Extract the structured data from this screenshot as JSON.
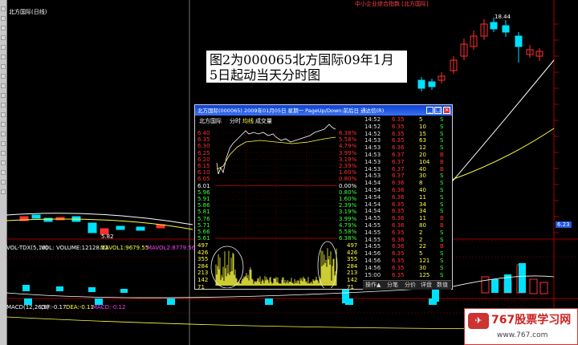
{
  "main_chart": {
    "title": "北方国际(日线)",
    "top_legend": "中小企业综合指数 [北方国际]",
    "high_label": "18.44",
    "low_label": "5.82",
    "current_price_tag": "6.23"
  },
  "volume_indicator": {
    "name": "VOL-TDX(5,10)",
    "vol_label": "VOL:",
    "volume": "VOLUME:12128.12",
    "mavol1": "MAVOL1:9679.55",
    "mavol2": "MAVOL2:8779.56"
  },
  "macd_indicator": {
    "name": "MACD(12,26,9)",
    "dif": "DIF:-0.17",
    "dea": "DEA:-0.11",
    "macd": "MACD:-0.12"
  },
  "annotation": {
    "line1": "图2为000065北方国际09年1月",
    "line2": "5日起动当天分时图"
  },
  "popup": {
    "title": "北方国际(000065)   2009年01月05日 星期一 PageUp/Down:前后日 通达信(R)",
    "min_label": "_",
    "max_label": "□",
    "close_label": "×",
    "legend_name": "北方国际",
    "legend_time": "分时",
    "legend_avg": "均线",
    "legend_vol": "成交量",
    "price_labels": [
      "6.40",
      "6.35",
      "6.30",
      "6.25",
      "6.20",
      "6.15",
      "6.10",
      "6.05",
      "6.01",
      "5.96",
      "5.91",
      "5.86",
      "5.81",
      "5.76",
      "5.71",
      "5.66",
      "5.61"
    ],
    "pct_labels": [
      "6.38%",
      "5.58%",
      "4.79%",
      "3.99%",
      "3.19%",
      "2.39%",
      "1.60%",
      "0.80%",
      "0.00%",
      "0.80%",
      "1.60%",
      "2.39%",
      "3.19%",
      "3.99%",
      "4.79%",
      "5.58%",
      "6.38%"
    ],
    "vol_labels": [
      "497",
      "426",
      "355",
      "284",
      "213",
      "142",
      "71"
    ],
    "vol_labels_right": [
      "497",
      "426",
      "355",
      "284",
      "213",
      "142",
      "71"
    ],
    "trades": [
      {
        "time": "14:52",
        "price": "6.35",
        "vol": "5",
        "dir": "S"
      },
      {
        "time": "14:52",
        "price": "6.35",
        "vol": "10",
        "dir": "S"
      },
      {
        "time": "14:52",
        "price": "6.35",
        "vol": "15",
        "dir": "S"
      },
      {
        "time": "14:53",
        "price": "6.35",
        "vol": "63",
        "dir": "S"
      },
      {
        "time": "14:53",
        "price": "6.36",
        "vol": "12",
        "dir": "S"
      },
      {
        "time": "14:53",
        "price": "6.37",
        "vol": "20",
        "dir": "B"
      },
      {
        "time": "14:53",
        "price": "6.37",
        "vol": "104",
        "dir": "B"
      },
      {
        "time": "14:53",
        "price": "6.37",
        "vol": "40",
        "dir": "B"
      },
      {
        "time": "14:53",
        "price": "6.37",
        "vol": "30",
        "dir": "S"
      },
      {
        "time": "14:54",
        "price": "6.36",
        "vol": "8",
        "dir": "S"
      },
      {
        "time": "14:54",
        "price": "6.36",
        "vol": "40",
        "dir": "S"
      },
      {
        "time": "14:54",
        "price": "6.36",
        "vol": "11",
        "dir": "S"
      },
      {
        "time": "14:54",
        "price": "6.35",
        "vol": "34",
        "dir": "S"
      },
      {
        "time": "14:54",
        "price": "6.35",
        "vol": "34",
        "dir": "S"
      },
      {
        "time": "14:55",
        "price": "6.36",
        "vol": "11",
        "dir": "B"
      },
      {
        "time": "14:55",
        "price": "6.36",
        "vol": "80",
        "dir": "B"
      },
      {
        "time": "14:55",
        "price": "6.35",
        "vol": "2",
        "dir": "S"
      },
      {
        "time": "14:55",
        "price": "6.36",
        "vol": "2",
        "dir": "S"
      },
      {
        "time": "14:55",
        "price": "6.36",
        "vol": "22",
        "dir": "B"
      },
      {
        "time": "14:56",
        "price": "6.35",
        "vol": "5",
        "dir": "S"
      },
      {
        "time": "14:56",
        "price": "6.35",
        "vol": "121",
        "dir": "S"
      },
      {
        "time": "14:56",
        "price": "6.35",
        "vol": "30",
        "dir": "S"
      },
      {
        "time": "15:00",
        "price": "6.35",
        "vol": "125",
        "dir": "S"
      }
    ],
    "tabs": [
      "操作▲",
      "分笔",
      "分价",
      "详盘",
      "数值"
    ]
  },
  "watermark": {
    "text": "767股票学习网",
    "url": "www.767.com"
  },
  "colors": {
    "up": "#ff3030",
    "down": "#00e0ff",
    "ma_white": "#ffffff",
    "ma_yellow": "#ffff40",
    "ma_purple": "#ff40ff",
    "grid_red": "#8a0000",
    "popup_title_bg": "#1f55e0"
  }
}
